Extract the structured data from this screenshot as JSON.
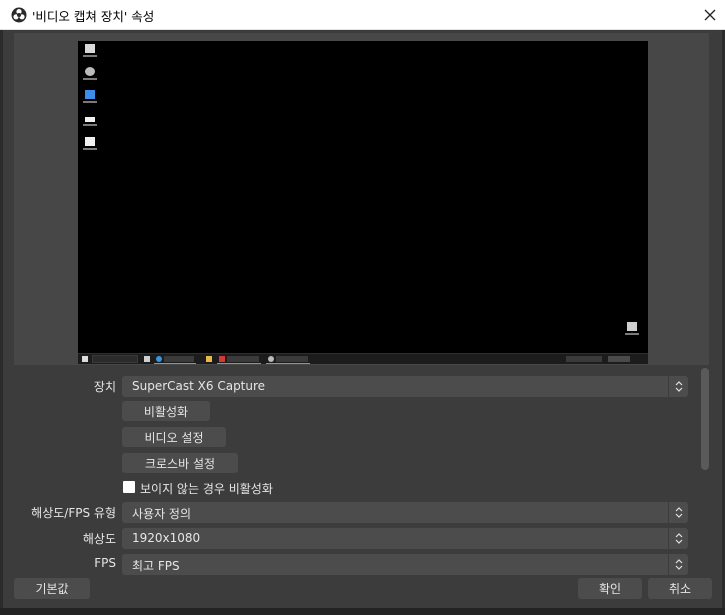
{
  "window": {
    "title": "'비디오 캡쳐 장치' 속성",
    "icon": "obs-logo-icon",
    "close_icon": "close-icon"
  },
  "preview": {
    "taskbar_items": [
      "start-icon",
      "search-box",
      "edge-browser",
      "file-explorer",
      "folder-window",
      "obs-window",
      "system-tray",
      "clock"
    ]
  },
  "form": {
    "device_label": "장치",
    "device_value": "SuperCast X6 Capture",
    "deactivate_button": "비활성화",
    "video_settings_button": "비디오 설정",
    "crossbar_settings_button": "크로스바 설정",
    "deactivate_when_hidden_label": "보이지 않는 경우 비활성화",
    "deactivate_when_hidden_checked": false,
    "resolution_fps_type_label": "해상도/FPS 유형",
    "resolution_fps_type_value": "사용자 정의",
    "resolution_label": "해상도",
    "resolution_value": "1920x1080",
    "fps_label": "FPS",
    "fps_value": "최고 FPS"
  },
  "footer": {
    "defaults_button": "기본값",
    "ok_button": "확인",
    "cancel_button": "취소"
  },
  "colors": {
    "dialog_bg": "#3c3c3c",
    "control_bg": "#4c4c4c",
    "text": "#e6e6e6"
  }
}
